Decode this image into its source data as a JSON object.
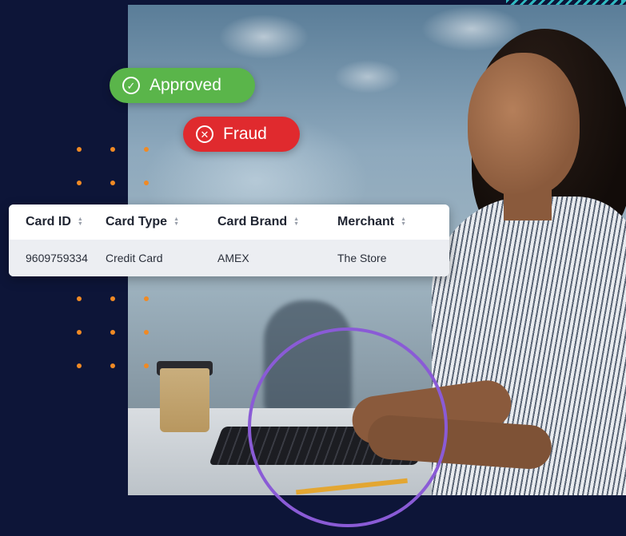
{
  "badges": {
    "approved": {
      "label": "Approved",
      "icon": "check-circle-icon",
      "color": "#5ab54a"
    },
    "fraud": {
      "label": "Fraud",
      "icon": "x-circle-icon",
      "color": "#e02a2e"
    }
  },
  "table": {
    "headers": [
      "Card ID",
      "Card Type",
      "Card Brand",
      "Merchant"
    ],
    "rows": [
      [
        "9609759334",
        "Credit Card",
        "AMEX",
        "The Store"
      ]
    ]
  },
  "colors": {
    "background": "#0d1538",
    "accent_dots": "#f08a24",
    "ring": "#8a5bd6",
    "stripes": "#2fb9c1"
  }
}
